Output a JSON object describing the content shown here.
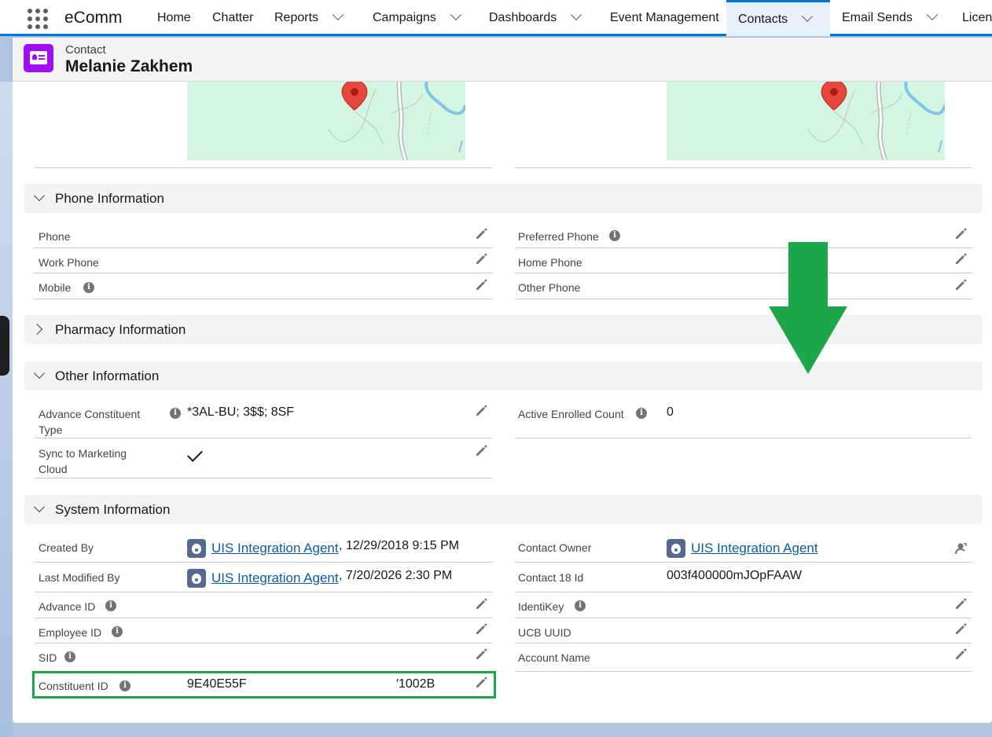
{
  "nav": {
    "app_name": "eComm",
    "items": [
      {
        "label": "Home"
      },
      {
        "label": "Chatter"
      },
      {
        "label": "Reports"
      },
      {
        "label": "Campaigns"
      },
      {
        "label": "Dashboards"
      },
      {
        "label": "Event Management"
      },
      {
        "label": "Contacts"
      },
      {
        "label": "Email Sends"
      },
      {
        "label": "Licens"
      }
    ]
  },
  "record": {
    "type": "Contact",
    "name": "Melanie Zakhem"
  },
  "sections": {
    "phone": {
      "title": "Phone Information",
      "fields": {
        "phone": "Phone",
        "preferred_phone": "Preferred Phone",
        "work_phone": "Work Phone",
        "home_phone": "Home Phone",
        "mobile": "Mobile",
        "other_phone": "Other Phone"
      }
    },
    "pharmacy": {
      "title": "Pharmacy Information"
    },
    "other": {
      "title": "Other Information",
      "advance_constituent_type_label": "Advance Constituent Type",
      "advance_constituent_type_value": "*3AL-BU; 3$$; 8SF",
      "sync_label": "Sync to Marketing Cloud",
      "sync_checked": true,
      "active_enrolled_label": "Active Enrolled Count",
      "active_enrolled_value": "0"
    },
    "system": {
      "title": "System Information",
      "created_by_label": "Created By",
      "created_by_user": "UIS Integration Agent",
      "created_by_sep": ",",
      "created_by_date": "12/29/2018 9:15 PM",
      "last_modified_label": "Last Modified By",
      "last_modified_user": "UIS Integration Agent",
      "last_modified_sep": ",",
      "last_modified_date": "7/20/2026 2:30 PM",
      "contact_owner_label": "Contact Owner",
      "contact_owner_user": "UIS Integration Agent",
      "contact_18_label": "Contact 18 Id",
      "contact_18_value": "003f400000mJOpFAAW",
      "advance_id_label": "Advance ID",
      "identikey_label": "IdentiKey",
      "employee_id_label": "Employee ID",
      "ucb_uuid_label": "UCB UUID",
      "sid_label": "SID",
      "account_name_label": "Account Name",
      "constituent_id_label": "Constituent ID",
      "constituent_id_value_a": "9E40E55F",
      "constituent_id_value_b": "′1002B"
    }
  },
  "colors": {
    "accent": "#0176d3",
    "record_icon": "#a10ef1",
    "arrow": "#1da74a",
    "link": "#0b5cab"
  },
  "icons": {
    "waffle": "app-launcher-icon",
    "pencil": "edit-pencil-icon",
    "info": "info-icon",
    "map_pin": "map-pin-icon",
    "owner_change": "change-owner-icon",
    "arrow": "down-arrow-icon"
  }
}
